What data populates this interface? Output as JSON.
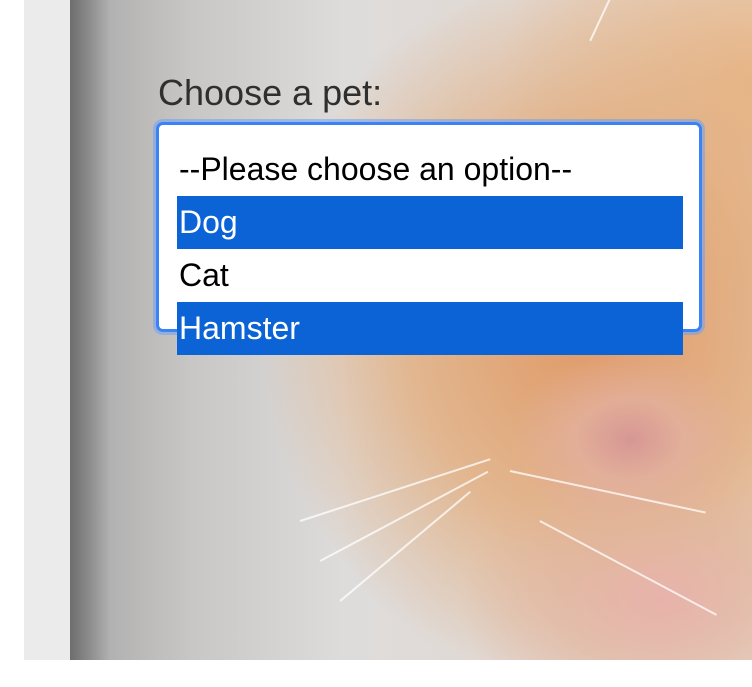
{
  "form": {
    "label": "Choose a pet:",
    "select": {
      "options": [
        {
          "label": "--Please choose an option--",
          "selected": false
        },
        {
          "label": "Dog",
          "selected": true
        },
        {
          "label": "Cat",
          "selected": false
        },
        {
          "label": "Hamster",
          "selected": true
        }
      ],
      "selected_color": "#0b63d6",
      "focus_ring_color": "#3b82f6"
    }
  },
  "background": {
    "image": "hamster-photo"
  }
}
